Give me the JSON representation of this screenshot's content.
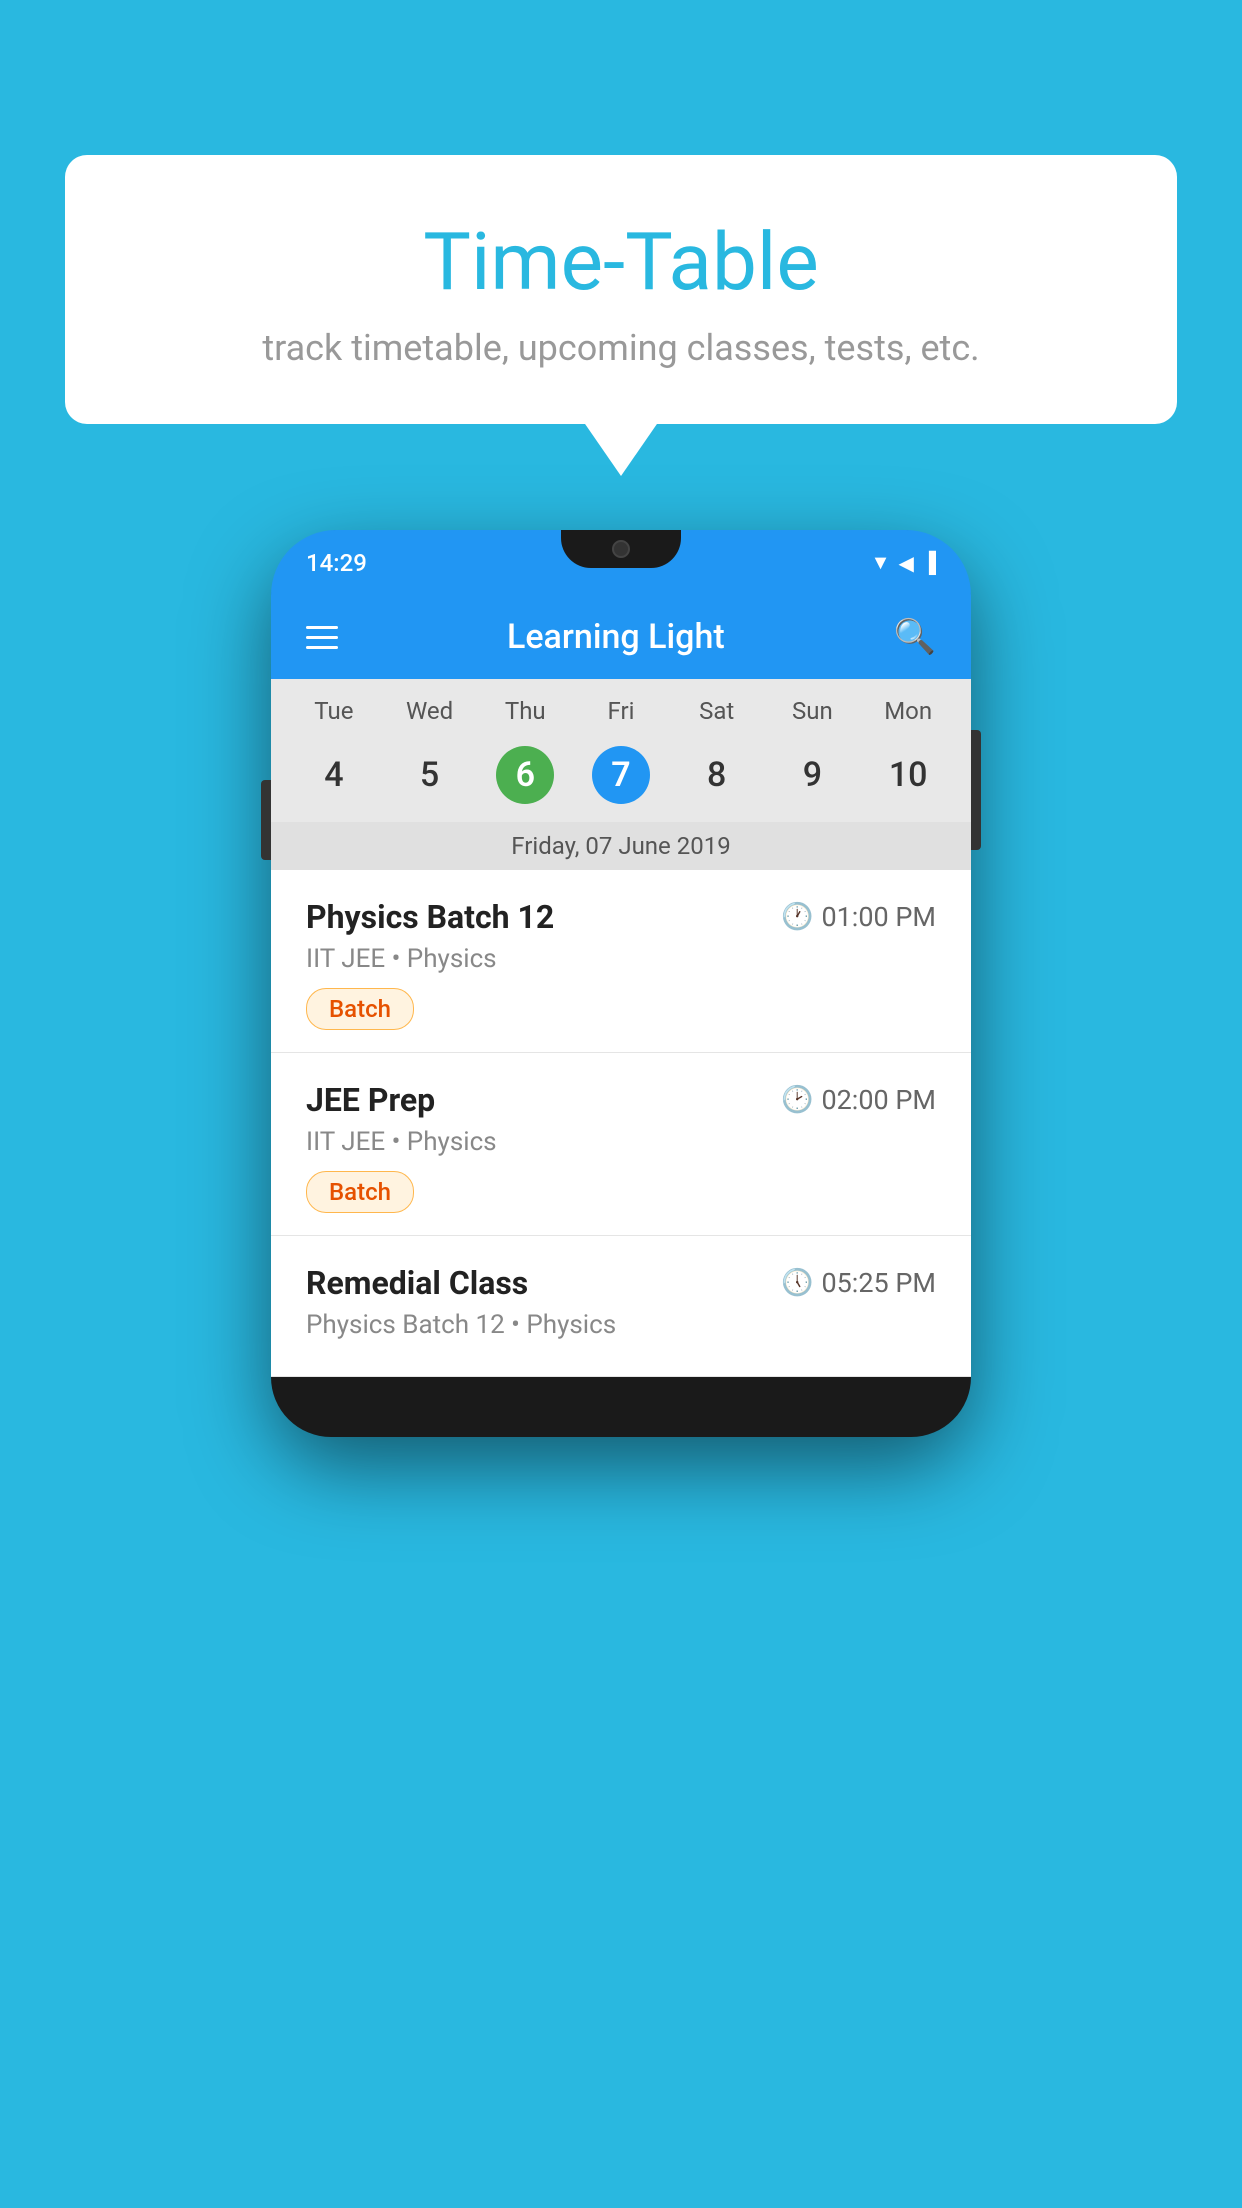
{
  "background_color": "#29b8e0",
  "bubble": {
    "title": "Time-Table",
    "subtitle": "track timetable, upcoming classes, tests, etc."
  },
  "phone": {
    "status_bar": {
      "time": "14:29"
    },
    "app_header": {
      "title": "Learning Light"
    },
    "calendar": {
      "day_names": [
        "Tue",
        "Wed",
        "Thu",
        "Fri",
        "Sat",
        "Sun",
        "Mon"
      ],
      "dates": [
        "4",
        "5",
        "6",
        "7",
        "8",
        "9",
        "10"
      ],
      "today_index": 2,
      "selected_index": 3,
      "selected_date_label": "Friday, 07 June 2019"
    },
    "schedule_items": [
      {
        "title": "Physics Batch 12",
        "time": "01:00 PM",
        "meta": "IIT JEE • Physics",
        "tag": "Batch"
      },
      {
        "title": "JEE Prep",
        "time": "02:00 PM",
        "meta": "IIT JEE • Physics",
        "tag": "Batch"
      },
      {
        "title": "Remedial Class",
        "time": "05:25 PM",
        "meta": "Physics Batch 12 • Physics",
        "tag": ""
      }
    ]
  }
}
